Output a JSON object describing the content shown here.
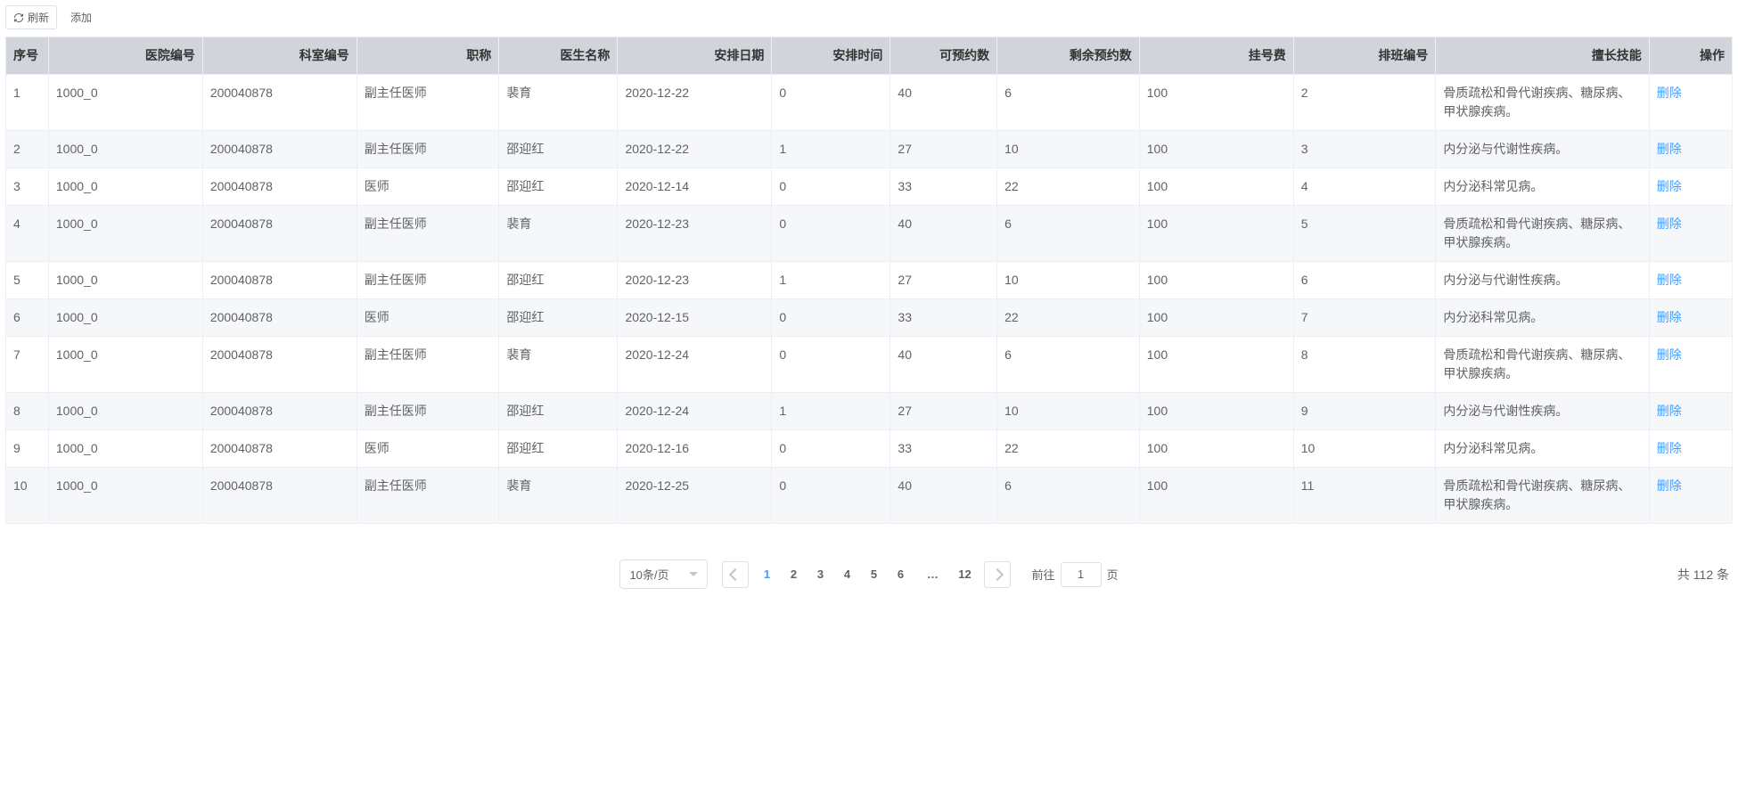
{
  "toolbar": {
    "refresh_label": "刷新",
    "add_label": "添加"
  },
  "table": {
    "headers": {
      "index": "序号",
      "hospital_no": "医院编号",
      "dept_no": "科室编号",
      "title": "职称",
      "doctor_name": "医生名称",
      "date": "安排日期",
      "time": "安排时间",
      "available": "可预约数",
      "remaining": "剩余预约数",
      "fee": "挂号费",
      "schedule_no": "排班编号",
      "skill": "擅长技能",
      "action": "操作"
    },
    "action_label": "删除",
    "rows": [
      {
        "idx": "1",
        "hospital": "1000_0",
        "dept": "200040878",
        "title": "副主任医师",
        "doctor": "裴育",
        "date": "2020-12-22",
        "time": "0",
        "available": "40",
        "remaining": "6",
        "fee": "100",
        "sched": "2",
        "skill": "骨质疏松和骨代谢疾病、糖尿病、甲状腺疾病。"
      },
      {
        "idx": "2",
        "hospital": "1000_0",
        "dept": "200040878",
        "title": "副主任医师",
        "doctor": "邵迎红",
        "date": "2020-12-22",
        "time": "1",
        "available": "27",
        "remaining": "10",
        "fee": "100",
        "sched": "3",
        "skill": "内分泌与代谢性疾病。"
      },
      {
        "idx": "3",
        "hospital": "1000_0",
        "dept": "200040878",
        "title": "医师",
        "doctor": "邵迎红",
        "date": "2020-12-14",
        "time": "0",
        "available": "33",
        "remaining": "22",
        "fee": "100",
        "sched": "4",
        "skill": "内分泌科常见病。"
      },
      {
        "idx": "4",
        "hospital": "1000_0",
        "dept": "200040878",
        "title": "副主任医师",
        "doctor": "裴育",
        "date": "2020-12-23",
        "time": "0",
        "available": "40",
        "remaining": "6",
        "fee": "100",
        "sched": "5",
        "skill": "骨质疏松和骨代谢疾病、糖尿病、甲状腺疾病。"
      },
      {
        "idx": "5",
        "hospital": "1000_0",
        "dept": "200040878",
        "title": "副主任医师",
        "doctor": "邵迎红",
        "date": "2020-12-23",
        "time": "1",
        "available": "27",
        "remaining": "10",
        "fee": "100",
        "sched": "6",
        "skill": "内分泌与代谢性疾病。"
      },
      {
        "idx": "6",
        "hospital": "1000_0",
        "dept": "200040878",
        "title": "医师",
        "doctor": "邵迎红",
        "date": "2020-12-15",
        "time": "0",
        "available": "33",
        "remaining": "22",
        "fee": "100",
        "sched": "7",
        "skill": "内分泌科常见病。"
      },
      {
        "idx": "7",
        "hospital": "1000_0",
        "dept": "200040878",
        "title": "副主任医师",
        "doctor": "裴育",
        "date": "2020-12-24",
        "time": "0",
        "available": "40",
        "remaining": "6",
        "fee": "100",
        "sched": "8",
        "skill": "骨质疏松和骨代谢疾病、糖尿病、甲状腺疾病。"
      },
      {
        "idx": "8",
        "hospital": "1000_0",
        "dept": "200040878",
        "title": "副主任医师",
        "doctor": "邵迎红",
        "date": "2020-12-24",
        "time": "1",
        "available": "27",
        "remaining": "10",
        "fee": "100",
        "sched": "9",
        "skill": "内分泌与代谢性疾病。"
      },
      {
        "idx": "9",
        "hospital": "1000_0",
        "dept": "200040878",
        "title": "医师",
        "doctor": "邵迎红",
        "date": "2020-12-16",
        "time": "0",
        "available": "33",
        "remaining": "22",
        "fee": "100",
        "sched": "10",
        "skill": "内分泌科常见病。"
      },
      {
        "idx": "10",
        "hospital": "1000_0",
        "dept": "200040878",
        "title": "副主任医师",
        "doctor": "裴育",
        "date": "2020-12-25",
        "time": "0",
        "available": "40",
        "remaining": "6",
        "fee": "100",
        "sched": "11",
        "skill": "骨质疏松和骨代谢疾病、糖尿病、甲状腺疾病。"
      }
    ]
  },
  "pagination": {
    "page_size_label": "10条/页",
    "pages": [
      "1",
      "2",
      "3",
      "4",
      "5",
      "6"
    ],
    "ellipsis": "…",
    "last_page": "12",
    "current": "1",
    "goto_prefix": "前往",
    "goto_value": "1",
    "goto_suffix": "页",
    "total_text": "共 112 条"
  }
}
